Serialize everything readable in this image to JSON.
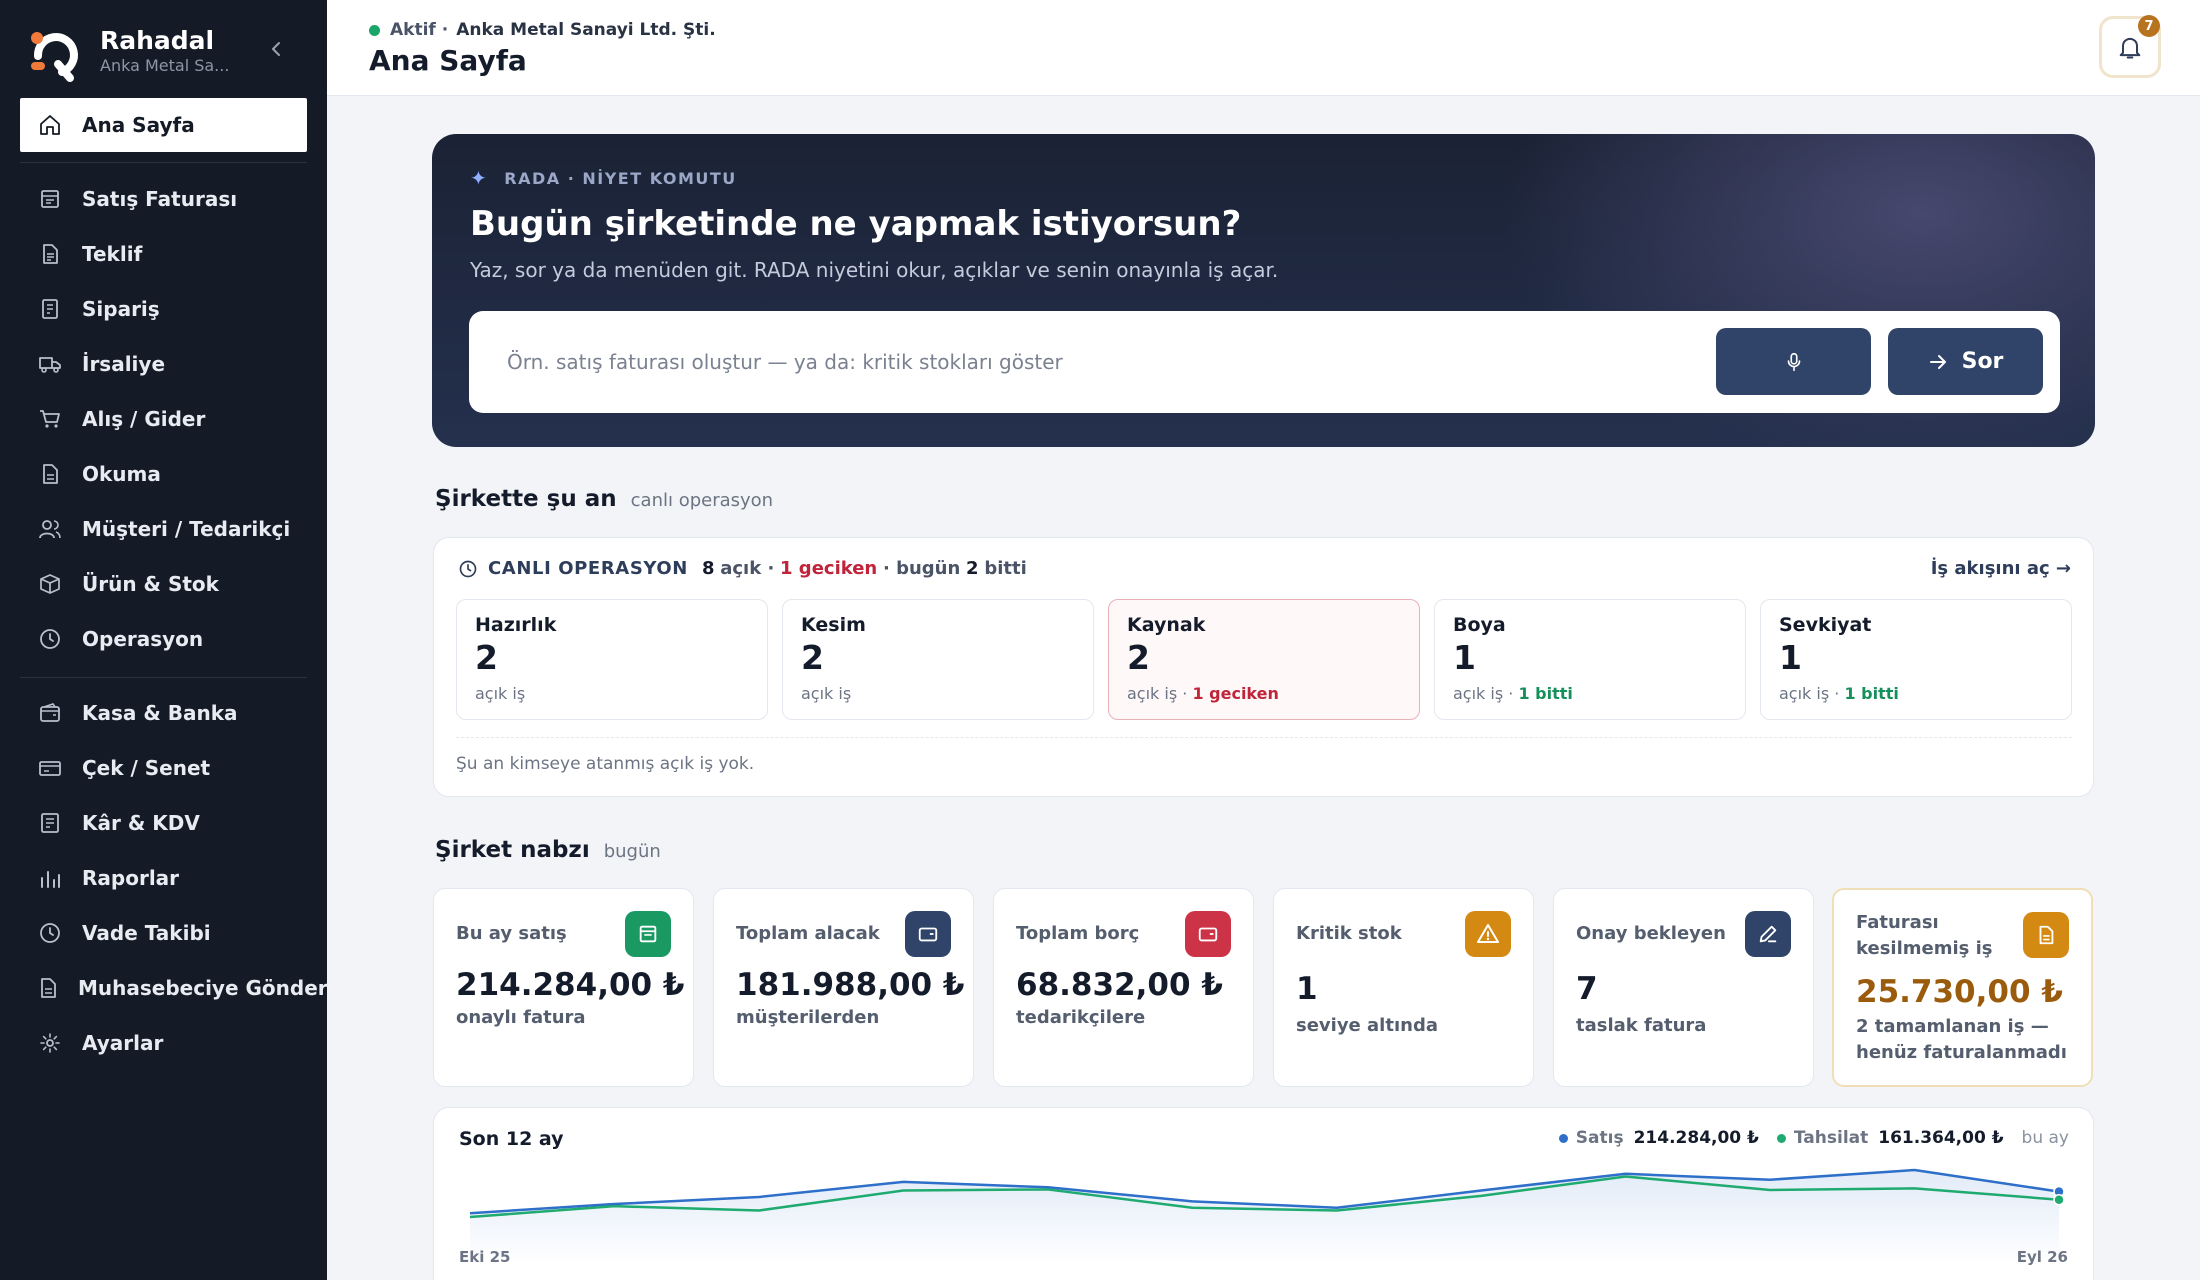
{
  "sidebar": {
    "brand_name": "Rahadal",
    "brand_sub": "Anka Metal Sa...",
    "items": [
      {
        "label": "Ana Sayfa",
        "icon": "home-icon"
      },
      {
        "label": "Satış Faturası",
        "icon": "invoice-icon"
      },
      {
        "label": "Teklif",
        "icon": "quote-icon"
      },
      {
        "label": "Sipariş",
        "icon": "order-icon"
      },
      {
        "label": "İrsaliye",
        "icon": "truck-icon"
      },
      {
        "label": "Alış / Gider",
        "icon": "cart-icon"
      },
      {
        "label": "Okuma",
        "icon": "document-icon"
      },
      {
        "label": "Müşteri / Tedarikçi",
        "icon": "users-icon"
      },
      {
        "label": "Ürün & Stok",
        "icon": "box-icon"
      },
      {
        "label": "Operasyon",
        "icon": "clock-icon"
      },
      {
        "label": "Kasa & Banka",
        "icon": "wallet-icon"
      },
      {
        "label": "Çek / Senet",
        "icon": "card-icon"
      },
      {
        "label": "Kâr & KDV",
        "icon": "ledger-icon"
      },
      {
        "label": "Raporlar",
        "icon": "bar-chart-icon"
      },
      {
        "label": "Vade Takibi",
        "icon": "clock-icon"
      },
      {
        "label": "Muhasebeciye Gönder",
        "icon": "file-icon"
      },
      {
        "label": "Ayarlar",
        "icon": "settings-icon"
      }
    ]
  },
  "header": {
    "status": "Aktif ·",
    "company": "Anka Metal Sanayi Ltd. Şti.",
    "title": "Ana Sayfa",
    "notification_count": "7"
  },
  "hero": {
    "kicker": "RADA · NİYET KOMUTU",
    "title": "Bugün şirketinde ne yapmak istiyorsun?",
    "subtitle": "Yaz, sor ya da menüden git. RADA niyetini okur, açıklar ve senin onayınla iş açar.",
    "placeholder": "Örn. satış faturası oluştur — ya da: kritik stokları göster",
    "ask_label": "Sor"
  },
  "live": {
    "title": "Şirkette şu an",
    "subtitle": "canlı operasyon",
    "caption": "CANLI OPERASYON",
    "open_count": "8",
    "open_word": "açık ·",
    "late_text": "1 geciken",
    "today_word": "· bugün",
    "done_count": "2",
    "done_word": "bitti",
    "link": "İş akışını aç →",
    "stages": [
      {
        "name": "Hazırlık",
        "count": "2",
        "foot": "açık iş",
        "extra": "",
        "extra_type": ""
      },
      {
        "name": "Kesim",
        "count": "2",
        "foot": "açık iş",
        "extra": "",
        "extra_type": ""
      },
      {
        "name": "Kaynak",
        "count": "2",
        "foot": "açık iş ·",
        "extra": "1 geciken",
        "extra_type": "late"
      },
      {
        "name": "Boya",
        "count": "1",
        "foot": "açık iş ·",
        "extra": "1 bitti",
        "extra_type": "done"
      },
      {
        "name": "Sevkiyat",
        "count": "1",
        "foot": "açık iş ·",
        "extra": "1 bitti",
        "extra_type": "done"
      }
    ],
    "note": "Şu an kimseye atanmış açık iş yok."
  },
  "pulse": {
    "title": "Şirket nabzı",
    "subtitle": "bugün",
    "cards": [
      {
        "label": "Bu ay satış",
        "value": "214.284,00 ₺",
        "sub": "onaylı fatura",
        "icon": "invoice-icon",
        "color": "#1a9a62"
      },
      {
        "label": "Toplam alacak",
        "value": "181.988,00 ₺",
        "sub": "müşterilerden",
        "icon": "wallet-icon",
        "color": "#2f4468"
      },
      {
        "label": "Toplam borç",
        "value": "68.832,00 ₺",
        "sub": "tedarikçilere",
        "icon": "wallet-icon",
        "color": "#cc3347"
      },
      {
        "label": "Kritik stok",
        "value": "1",
        "sub": "seviye altında",
        "icon": "warning-icon",
        "color": "#d48a12"
      },
      {
        "label": "Onay bekleyen",
        "value": "7",
        "sub": "taslak fatura",
        "icon": "edit-icon",
        "color": "#2f4468"
      },
      {
        "label": "Faturası kesilmemiş iş",
        "value": "25.730,00 ₺",
        "sub": "2 tamamlanan iş — henüz faturalanmadı",
        "icon": "file-icon",
        "color": "#d48a12"
      }
    ]
  },
  "trend": {
    "title": "Son 12 ay",
    "legend_sales_label": "Satış",
    "legend_sales_value": "214.284,00 ₺",
    "legend_collect_label": "Tahsilat",
    "legend_collect_value": "161.364,00 ₺",
    "period": "bu ay",
    "x_start": "Eki 25",
    "x_end": "Eyl 26"
  },
  "chart_data": {
    "type": "line",
    "title": "Son 12 ay",
    "x": [
      "Eki 25",
      "",
      "",
      "",
      "",
      "",
      "",
      "",
      "",
      "",
      "",
      "Eyl 26"
    ],
    "series": [
      {
        "name": "Satış",
        "color": "#2d6fc9",
        "values": [
          0.2,
          0.37,
          0.5,
          0.78,
          0.68,
          0.42,
          0.3,
          0.62,
          0.93,
          0.82,
          1.0,
          0.6
        ]
      },
      {
        "name": "Tahsilat",
        "color": "#1faa6f",
        "values": [
          0.13,
          0.33,
          0.25,
          0.62,
          0.64,
          0.3,
          0.25,
          0.52,
          0.88,
          0.63,
          0.66,
          0.45
        ]
      }
    ]
  },
  "colors": {
    "sidebar": "#151b26",
    "hero": "#1f2740",
    "primary_button": "#2f4468",
    "late": "#c0243a",
    "done": "#15905a",
    "gold": "#9a5c0c"
  }
}
